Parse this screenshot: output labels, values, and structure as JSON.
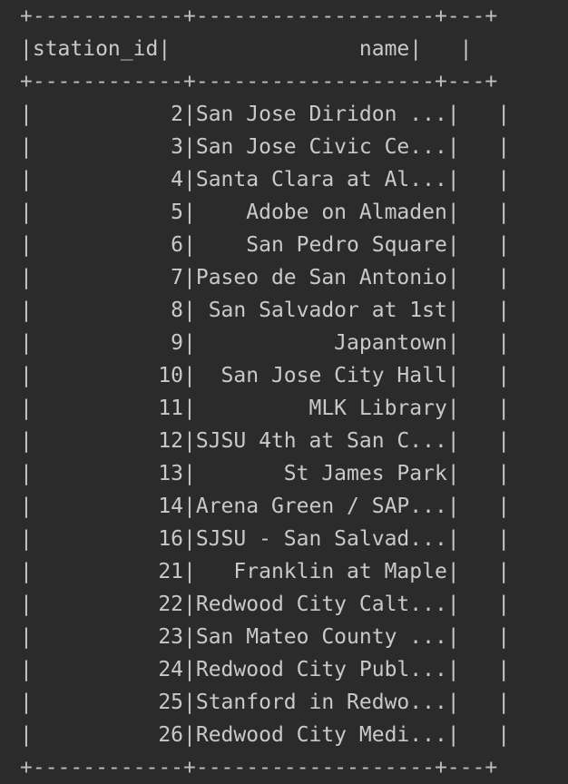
{
  "table": {
    "columns": [
      "station_id",
      "name",
      ""
    ],
    "border_top": "+------------+-------------------+---+",
    "header_line": "|station_id|               name|   |",
    "border_mid": "+------------+-------------------+---+",
    "rows": [
      "|           2|San Jose Diridon ...|   |",
      "|           3|San Jose Civic Ce...|   |",
      "|           4|Santa Clara at Al...|   |",
      "|           5|    Adobe on Almaden|   |",
      "|           6|    San Pedro Square|   |",
      "|           7|Paseo de San Antonio|   |",
      "|           8| San Salvador at 1st|   |",
      "|           9|           Japantown|   |",
      "|          10|  San Jose City Hall|   |",
      "|          11|         MLK Library|   |",
      "|          12|SJSU 4th at San C...|   |",
      "|          13|       St James Park|   |",
      "|          14|Arena Green / SAP...|   |",
      "|          16|SJSU - San Salvad...|   |",
      "|          21|   Franklin at Maple|   |",
      "|          22|Redwood City Calt...|   |",
      "|          23|San Mateo County ...|   |",
      "|          24|Redwood City Publ...|   |",
      "|          25|Stanford in Redwo...|   |",
      "|          26|Redwood City Medi...|   |"
    ],
    "border_bottom": "+------------+-------------------+---+"
  },
  "cells": [
    {
      "station_id": "2",
      "name": "San Jose Diridon ..."
    },
    {
      "station_id": "3",
      "name": "San Jose Civic Ce..."
    },
    {
      "station_id": "4",
      "name": "Santa Clara at Al..."
    },
    {
      "station_id": "5",
      "name": "Adobe on Almaden"
    },
    {
      "station_id": "6",
      "name": "San Pedro Square"
    },
    {
      "station_id": "7",
      "name": "Paseo de San Antonio"
    },
    {
      "station_id": "8",
      "name": "San Salvador at 1st"
    },
    {
      "station_id": "9",
      "name": "Japantown"
    },
    {
      "station_id": "10",
      "name": "San Jose City Hall"
    },
    {
      "station_id": "11",
      "name": "MLK Library"
    },
    {
      "station_id": "12",
      "name": "SJSU 4th at San C..."
    },
    {
      "station_id": "13",
      "name": "St James Park"
    },
    {
      "station_id": "14",
      "name": "Arena Green / SAP..."
    },
    {
      "station_id": "16",
      "name": "SJSU - San Salvad..."
    },
    {
      "station_id": "21",
      "name": "Franklin at Maple"
    },
    {
      "station_id": "22",
      "name": "Redwood City Calt..."
    },
    {
      "station_id": "23",
      "name": "San Mateo County ..."
    },
    {
      "station_id": "24",
      "name": "Redwood City Publ..."
    },
    {
      "station_id": "25",
      "name": "Stanford in Redwo..."
    },
    {
      "station_id": "26",
      "name": "Redwood City Medi..."
    }
  ]
}
